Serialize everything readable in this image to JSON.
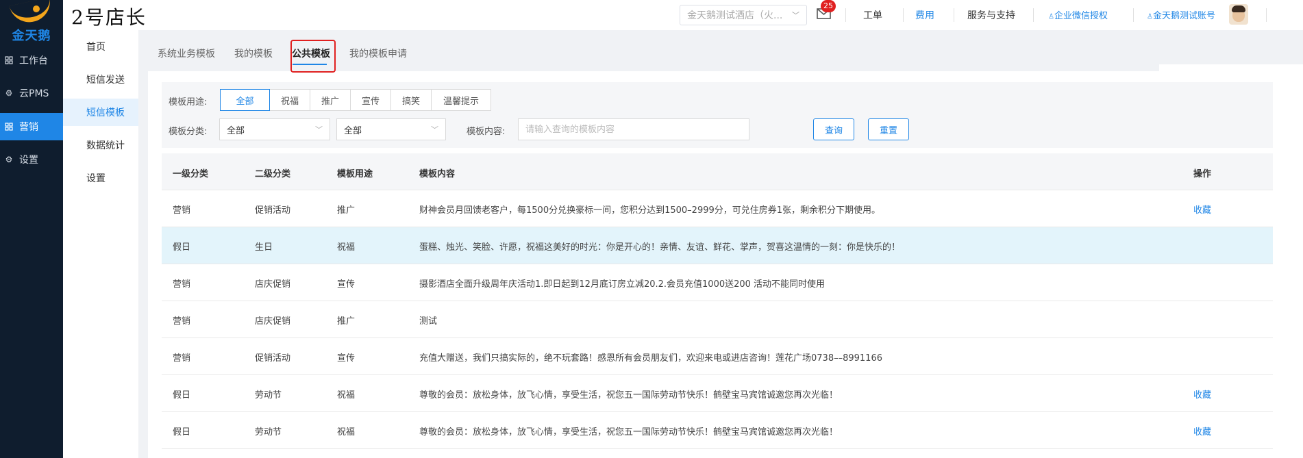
{
  "app": {
    "brand": "2号店长",
    "logo_text": "金天鹅"
  },
  "sidebar": {
    "items": [
      {
        "label": "工作台",
        "icon": "workbench-icon"
      },
      {
        "label": "云PMS",
        "icon": "gear-icon"
      },
      {
        "label": "营销",
        "icon": "workbench-icon",
        "active": true
      },
      {
        "label": "设置",
        "icon": "gear-icon"
      }
    ]
  },
  "header": {
    "store_select": "金天鹅测试酒店（火...",
    "mail_badge": "25",
    "links": {
      "work_order": "工单",
      "fees": "费用",
      "service": "服务与支持",
      "wechat_auth": "企业微信授权",
      "account": "金天鹅测试账号"
    }
  },
  "subnav": {
    "items": [
      {
        "label": "首页"
      },
      {
        "label": "短信发送"
      },
      {
        "label": "短信模板",
        "active": true
      },
      {
        "label": "数据统计"
      },
      {
        "label": "设置"
      }
    ]
  },
  "tabs": [
    {
      "label": "系统业务模板"
    },
    {
      "label": "我的模板"
    },
    {
      "label": "公共模板",
      "active": true
    },
    {
      "label": "我的模板申请"
    }
  ],
  "filter": {
    "purpose_label": "模板用途:",
    "purpose_options": [
      "全部",
      "祝福",
      "推广",
      "宣传",
      "搞笑",
      "温馨提示"
    ],
    "category_label": "模板分类:",
    "category1": "全部",
    "category2": "全部",
    "content_label": "模板内容:",
    "content_placeholder": "请输入查询的模板内容",
    "query_btn": "查询",
    "reset_btn": "重置"
  },
  "table": {
    "headers": [
      "一级分类",
      "二级分类",
      "模板用途",
      "模板内容",
      "操作"
    ],
    "rows": [
      {
        "c1": "营销",
        "c2": "促销活动",
        "c3": "推广",
        "c4": "财神会员月回馈老客户，每1500分兑换豪标一间，您积分达到1500–2999分，可兑住房券1张，剩余积分下期使用。",
        "action": "收藏"
      },
      {
        "c1": "假日",
        "c2": "生日",
        "c3": "祝福",
        "c4": "蛋糕、烛光、笑脸、许愿，祝福这美好的时光：你是开心的！亲情、友谊、鲜花、掌声，贺喜这温情的一刻：你是快乐的！",
        "action": ""
      },
      {
        "c1": "营销",
        "c2": "店庆促销",
        "c3": "宣传",
        "c4": "摄影酒店全面升级周年庆活动1.即日起到12月底订房立减20.2.会员充值1000送200 活动不能同时使用",
        "action": ""
      },
      {
        "c1": "营销",
        "c2": "店庆促销",
        "c3": "推广",
        "c4": "测试",
        "action": ""
      },
      {
        "c1": "营销",
        "c2": "促销活动",
        "c3": "宣传",
        "c4": "充值大赠送，我们只搞实际的，绝不玩套路！感恩所有会员朋友们，欢迎来电或进店咨询！莲花广场0738––8991166",
        "action": ""
      },
      {
        "c1": "假日",
        "c2": "劳动节",
        "c3": "祝福",
        "c4": "尊敬的会员：放松身体，放飞心情，享受生活，祝您五一国际劳动节快乐！鹤壁宝马宾馆诚邀您再次光临！",
        "action": "收藏"
      },
      {
        "c1": "假日",
        "c2": "劳动节",
        "c3": "祝福",
        "c4": "尊敬的会员：放松身体，放飞心情，享受生活，祝您五一国际劳动节快乐！鹤壁宝马宾馆诚邀您再次光临！",
        "action": "收藏"
      }
    ]
  },
  "colors": {
    "primary": "#1f86e6",
    "sidebar_bg": "#0f1d2e",
    "highlight_row": "#e3f4fb",
    "alert_red": "#e02020",
    "logo_gold": "#f3a51b"
  }
}
